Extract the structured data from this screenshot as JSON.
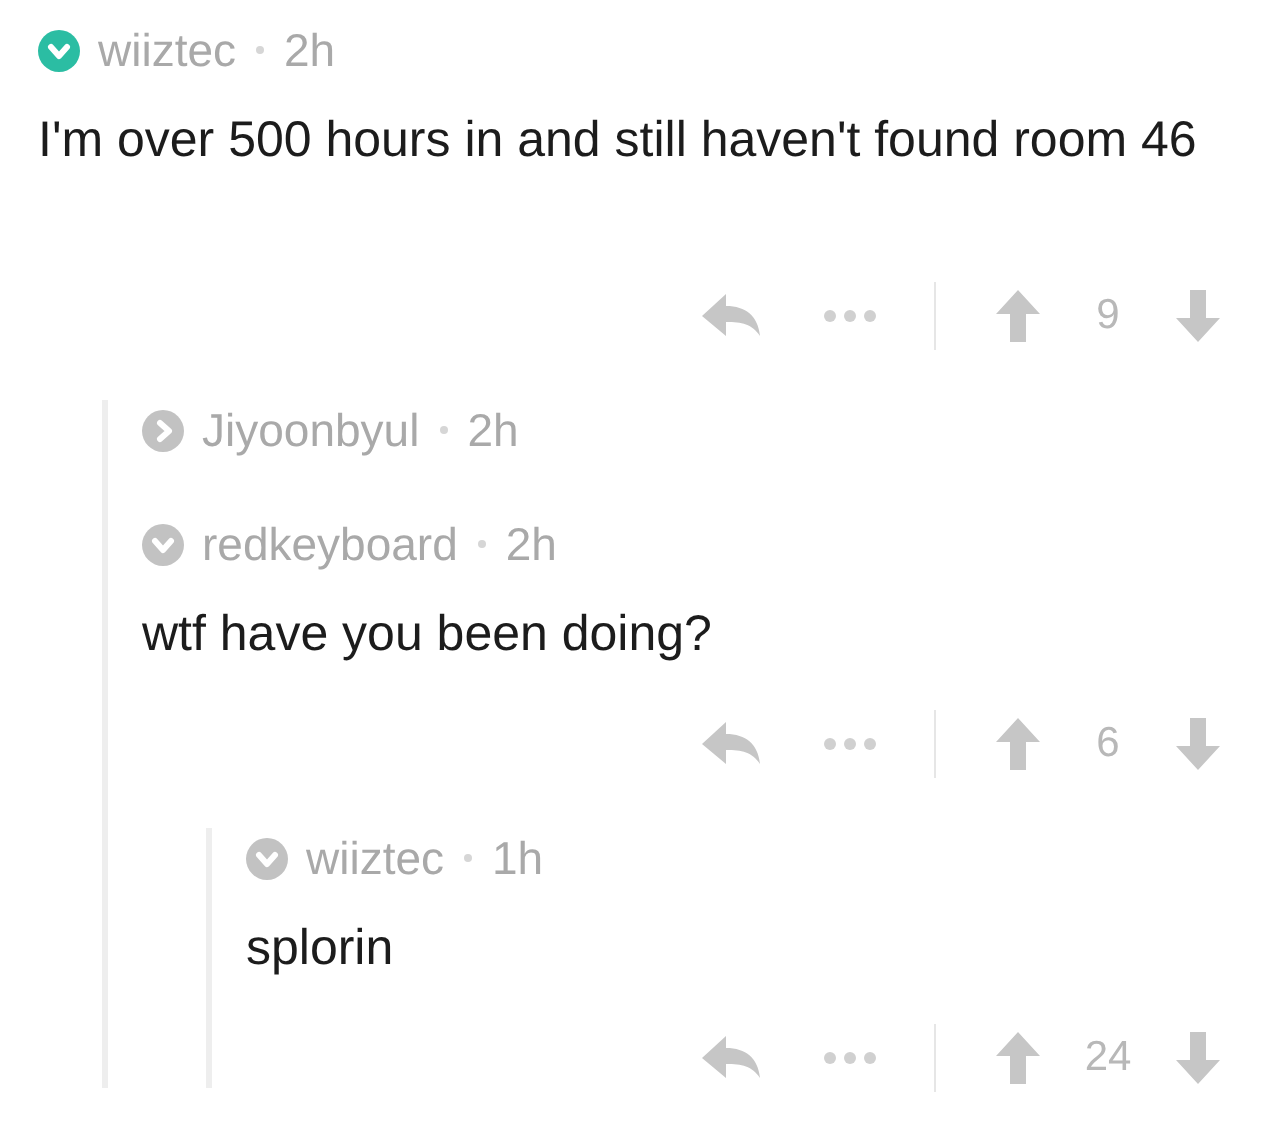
{
  "comments": [
    {
      "author": "wiiztec",
      "time": "2h",
      "color": "#2bbda3",
      "collapsed": false,
      "body": "I'm over 500 hours in and still haven't found room 46",
      "score": "9",
      "children": [
        {
          "author": "Jiyoonbyul",
          "time": "2h",
          "color": "#c2c2c2",
          "collapsed": true
        },
        {
          "author": "redkeyboard",
          "time": "2h",
          "color": "#c2c2c2",
          "collapsed": false,
          "body": "wtf have you been doing?",
          "score": "6",
          "children": [
            {
              "author": "wiiztec",
              "time": "1h",
              "color": "#c2c2c2",
              "collapsed": false,
              "body": "splorin",
              "score": "24"
            }
          ]
        }
      ]
    }
  ]
}
